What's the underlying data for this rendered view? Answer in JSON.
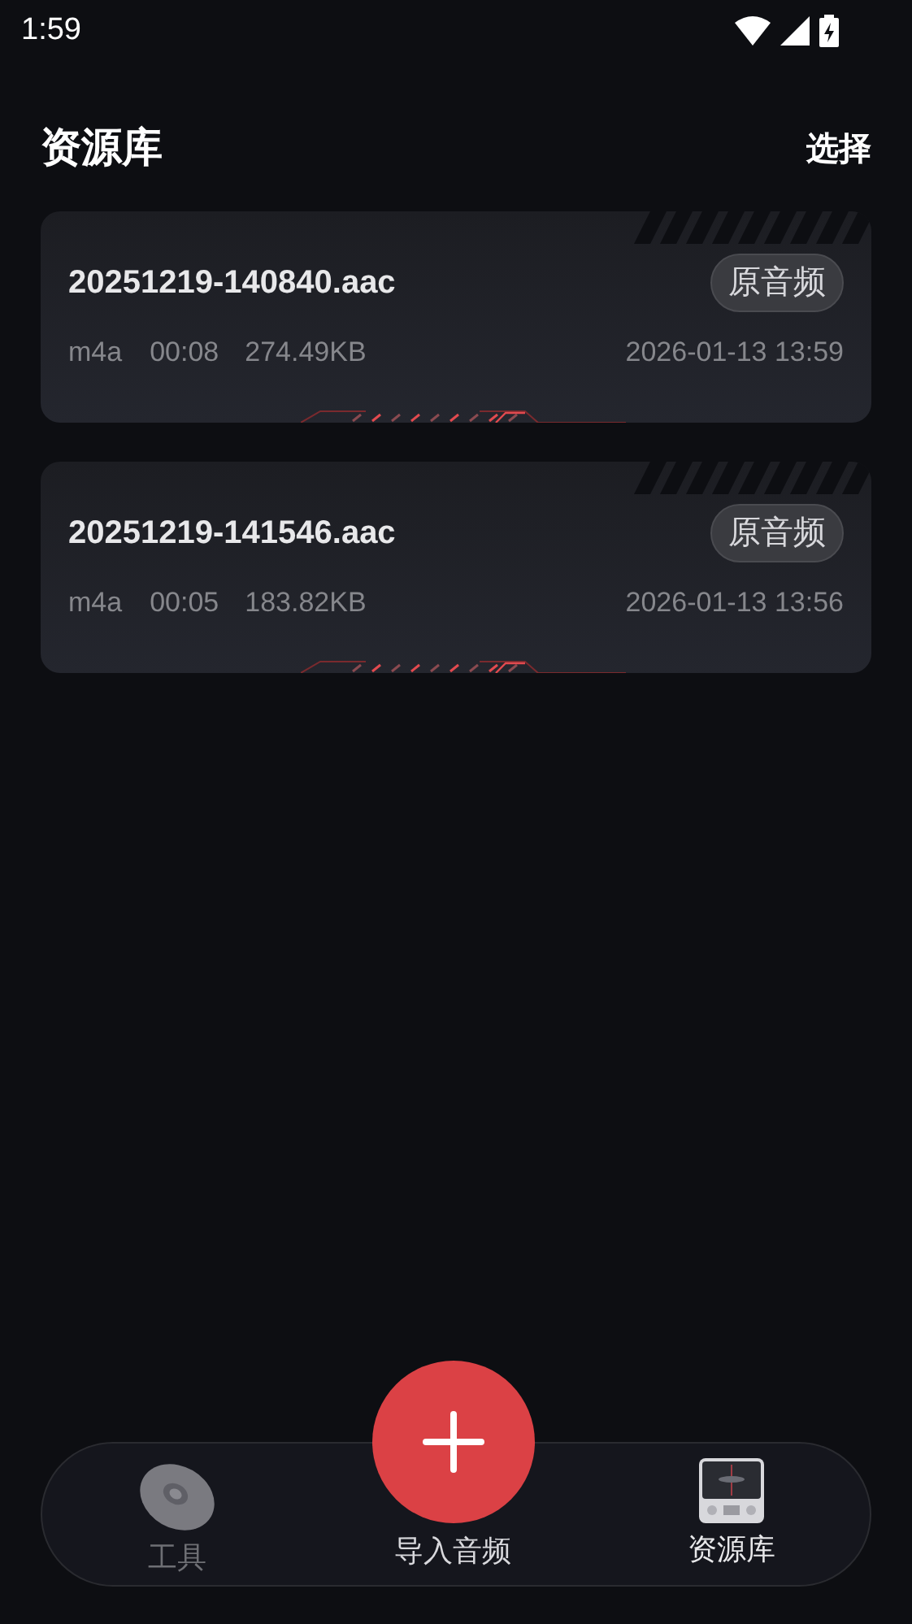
{
  "status_bar": {
    "time": "1:59"
  },
  "header": {
    "title": "资源库",
    "action": "选择"
  },
  "files": [
    {
      "name": "20251219-140840.aac",
      "tag": "原音频",
      "format": "m4a",
      "duration": "00:08",
      "size": "274.49KB",
      "date": "2026-01-13 13:59"
    },
    {
      "name": "20251219-141546.aac",
      "tag": "原音频",
      "format": "m4a",
      "duration": "00:05",
      "size": "183.82KB",
      "date": "2026-01-13 13:56"
    }
  ],
  "nav": [
    {
      "kind": "tab",
      "label": "工具",
      "selected": false
    },
    {
      "kind": "fab",
      "label": "导入音频"
    },
    {
      "kind": "tab",
      "label": "资源库",
      "selected": true
    }
  ]
}
